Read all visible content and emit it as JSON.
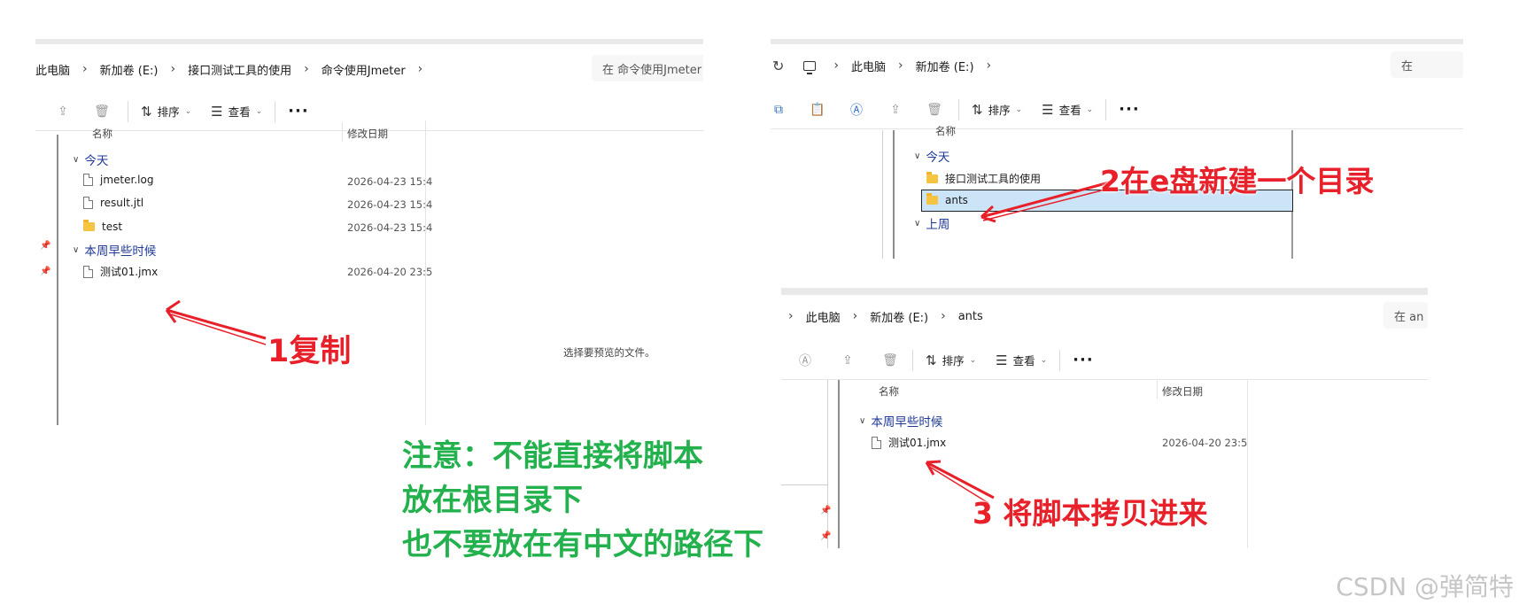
{
  "panel1": {
    "breadcrumbs": [
      "此电脑",
      "新加卷 (E:)",
      "接口测试工具的使用",
      "命令使用Jmeter"
    ],
    "search_placeholder": "在 命令使用Jmeter",
    "toolbar": {
      "sort": "排序",
      "view": "查看",
      "more": "···"
    },
    "columns": {
      "name": "名称",
      "modified": "修改日期"
    },
    "groups": {
      "today": "今天",
      "earlier": "本周早些时候"
    },
    "files": [
      {
        "name": "jmeter.log",
        "date": "2026-04-23 15:4",
        "type": "file"
      },
      {
        "name": "result.jtl",
        "date": "2026-04-23 15:4",
        "type": "file"
      },
      {
        "name": "test",
        "date": "2026-04-23 15:4",
        "type": "folder"
      },
      {
        "name": "测试01.jmx",
        "date": "2026-04-20 23:5",
        "type": "file"
      }
    ],
    "preview_hint": "选择要预览的文件。"
  },
  "panel2": {
    "breadcrumbs": [
      "此电脑",
      "新加卷 (E:)"
    ],
    "search_placeholder": "在",
    "toolbar": {
      "sort": "排序",
      "view": "查看",
      "more": "···"
    },
    "columns": {
      "name": "名称"
    },
    "groups": {
      "today": "今天",
      "last_week": "上周"
    },
    "files": [
      {
        "name": "接口测试工具的使用",
        "type": "folder"
      },
      {
        "name": "ants",
        "type": "folder",
        "selected": true
      }
    ]
  },
  "panel3": {
    "breadcrumbs": [
      "此电脑",
      "新加卷 (E:)",
      "ants"
    ],
    "search_placeholder": "在 an",
    "toolbar": {
      "sort": "排序",
      "view": "查看",
      "more": "···"
    },
    "columns": {
      "name": "名称",
      "modified": "修改日期"
    },
    "groups": {
      "earlier": "本周早些时候"
    },
    "files": [
      {
        "name": "测试01.jmx",
        "date": "2026-04-20 23:5",
        "type": "file"
      }
    ]
  },
  "annotations": {
    "step1": "1复制",
    "step2": "2在e盘新建一个目录",
    "step3": "3 将脚本拷贝进来",
    "note_line1": "注意：不能直接将脚本",
    "note_line2": "放在根目录下",
    "note_line3": "也不要放在有中文的路径下"
  },
  "watermark": "CSDN @弹简特",
  "colors": {
    "annotation_red": "#e8202a",
    "annotation_green": "#22b14c",
    "group_blue": "#1f3a9a",
    "selection": "#cce4f7"
  }
}
